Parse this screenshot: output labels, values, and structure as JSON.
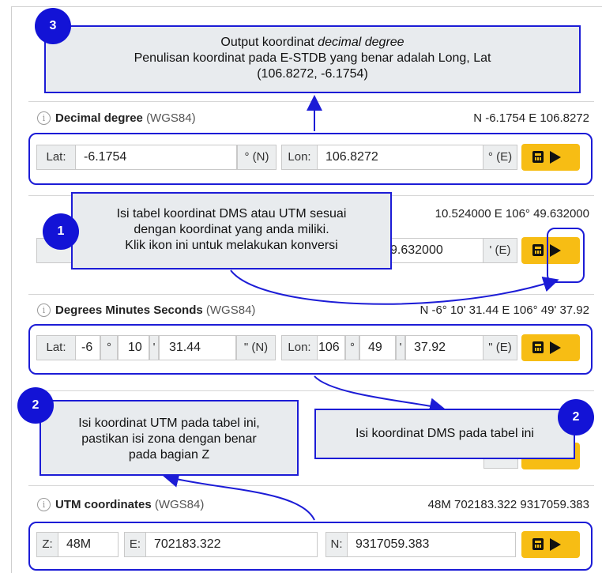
{
  "decimal": {
    "title": "Decimal degree",
    "datum": "(WGS84)",
    "summary": "N -6.1754 E 106.8272",
    "lat_label": "Lat:",
    "lat_value": "-6.1754",
    "lat_unit": "° (N)",
    "lon_label": "Lon:",
    "lon_value": "106.8272",
    "lon_unit": "° (E)"
  },
  "ddm": {
    "summary": "10.524000 E 106° 49.632000",
    "lon_value": "9.632000",
    "lon_unit": "' (E)"
  },
  "dms": {
    "title": "Degrees Minutes Seconds",
    "datum": "(WGS84)",
    "summary": "N -6° 10' 31.44 E 106° 49' 37.92",
    "lat_label": "Lat:",
    "lat_deg": "-6",
    "deg_sym": "°",
    "lat_min": "10",
    "min_sym": "'",
    "lat_sec": "31.44",
    "lat_unit": "\" (N)",
    "lon_label": "Lon:",
    "lon_deg": "106",
    "lon_min": "49",
    "lon_sec": "37.92",
    "lon_unit": "\" (E)"
  },
  "utm": {
    "title": "UTM coordinates",
    "datum": "(WGS84)",
    "summary": "48M 702183.322 9317059.383",
    "z_label": "Z:",
    "z_value": "48M",
    "e_label": "E:",
    "e_value": "702183.322",
    "n_label": "N:",
    "n_value": "9317059.383"
  },
  "callouts": {
    "one": {
      "badge": "1",
      "line1": "Isi tabel koordinat DMS atau UTM sesuai",
      "line2": "dengan koordinat yang anda miliki.",
      "line3": "Klik ikon ini untuk melakukan konversi"
    },
    "two_utm": {
      "badge": "2",
      "line1": "Isi koordinat UTM pada tabel ini,",
      "line2": "pastikan isi zona dengan benar",
      "line3": "pada bagian Z"
    },
    "two_dms": {
      "badge": "2",
      "line1": "Isi koordinat DMS pada tabel ini"
    },
    "three": {
      "badge": "3",
      "line1_prefix": "Output koordinat ",
      "line1_italic": "decimal degree",
      "line2": "Penulisan koordinat pada E-STDB yang benar adalah Long, Lat",
      "line3": "(106.8272, -6.1754)"
    }
  },
  "colors": {
    "accent": "#1c1cd6",
    "button": "#f7bd14",
    "callout_bg": "#e8ebee"
  },
  "icons": [
    "info-icon",
    "calculator-icon",
    "play-icon"
  ]
}
